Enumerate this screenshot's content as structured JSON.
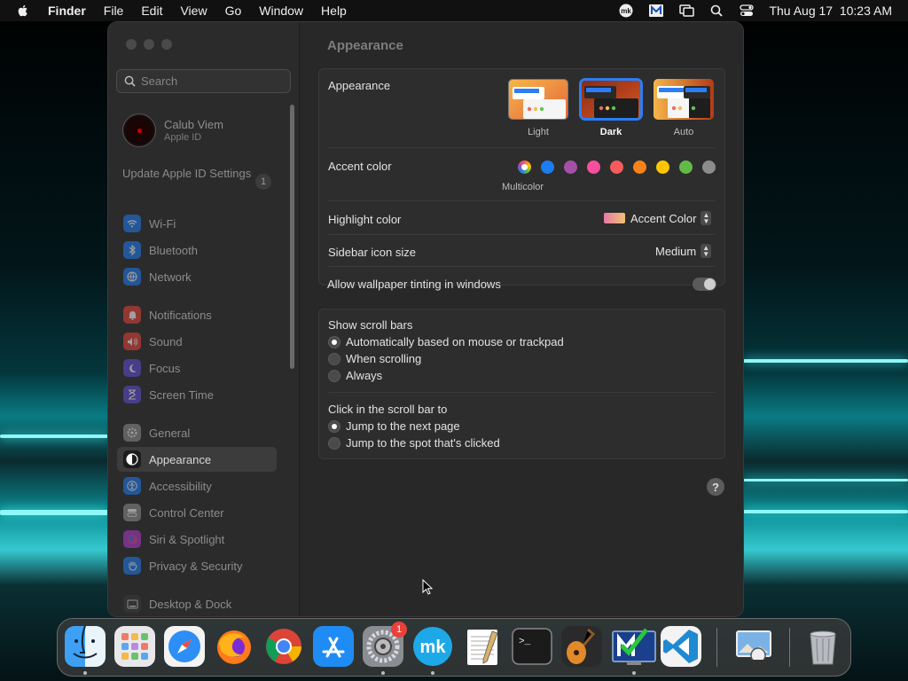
{
  "menubar": {
    "app_name": "Finder",
    "menus": [
      "File",
      "Edit",
      "View",
      "Go",
      "Window",
      "Help"
    ],
    "status_icons": [
      "mk-icon",
      "malwarebytes-icon",
      "display-icon",
      "search-icon",
      "control-center-icon"
    ],
    "datetime": "Thu Aug 17  10:23 AM"
  },
  "sidebar": {
    "search_placeholder": "Search",
    "profile": {
      "name": "Calub Viem",
      "subtitle": "Apple ID"
    },
    "update": {
      "label": "Update Apple ID Settings",
      "badge": "1"
    },
    "items": [
      {
        "label": "Wi-Fi",
        "icon": "wifi-icon",
        "color": "#1e7cf2"
      },
      {
        "label": "Bluetooth",
        "icon": "bluetooth-icon",
        "color": "#1e7cf2"
      },
      {
        "label": "Network",
        "icon": "globe-icon",
        "color": "#1e7cf2"
      },
      {
        "label": "Notifications",
        "icon": "bell-icon",
        "color": "#e8413b"
      },
      {
        "label": "Sound",
        "icon": "speaker-icon",
        "color": "#e8413b"
      },
      {
        "label": "Focus",
        "icon": "moon-icon",
        "color": "#5d4fd6"
      },
      {
        "label": "Screen Time",
        "icon": "hourglass-icon",
        "color": "#5d4fd6"
      },
      {
        "label": "General",
        "icon": "gear-icon",
        "color": "#8e8e8e"
      },
      {
        "label": "Appearance",
        "icon": "appearance-icon",
        "color": "#1c1c1c"
      },
      {
        "label": "Accessibility",
        "icon": "accessibility-icon",
        "color": "#1e7cf2"
      },
      {
        "label": "Control Center",
        "icon": "control-center-icon",
        "color": "#8e8e8e"
      },
      {
        "label": "Siri & Spotlight",
        "icon": "siri-icon",
        "color": "#b03bd0"
      },
      {
        "label": "Privacy & Security",
        "icon": "hand-icon",
        "color": "#1e7cf2"
      },
      {
        "label": "Desktop & Dock",
        "icon": "dock-icon",
        "color": "#3a3a3a"
      }
    ],
    "selected": "Appearance"
  },
  "main": {
    "title": "Appearance",
    "appearance": {
      "label": "Appearance",
      "options": [
        "Light",
        "Dark",
        "Auto"
      ],
      "selected": "Dark"
    },
    "accent": {
      "label": "Accent color",
      "colors": [
        "multicolor",
        "#1e7cf2",
        "#a550a7",
        "#f74f9e",
        "#f75b5b",
        "#f7821b",
        "#ffc600",
        "#62ba46",
        "#8c8c8c"
      ],
      "selected_label": "Multicolor"
    },
    "highlight": {
      "label": "Highlight color",
      "value": "Accent Color"
    },
    "sidebar_icon_size": {
      "label": "Sidebar icon size",
      "value": "Medium"
    },
    "wallpaper_tinting": {
      "label": "Allow wallpaper tinting in windows",
      "on": false
    },
    "scroll_bars": {
      "label": "Show scroll bars",
      "options": [
        "Automatically based on mouse or trackpad",
        "When scrolling",
        "Always"
      ],
      "selected": 0
    },
    "click_scroll": {
      "label": "Click in the scroll bar to",
      "options": [
        "Jump to the next page",
        "Jump to the spot that's clicked"
      ],
      "selected": 0
    },
    "help_label": "?"
  },
  "dock": {
    "apps": [
      {
        "name": "Finder",
        "icon": "finder-icon",
        "running": true
      },
      {
        "name": "Launchpad",
        "icon": "launchpad-icon",
        "running": false
      },
      {
        "name": "Safari",
        "icon": "safari-icon",
        "running": false
      },
      {
        "name": "Firefox",
        "icon": "firefox-icon",
        "running": false
      },
      {
        "name": "Chrome",
        "icon": "chrome-icon",
        "running": false
      },
      {
        "name": "App Store",
        "icon": "app-store-icon",
        "running": false
      },
      {
        "name": "System Settings",
        "icon": "system-settings-icon",
        "running": true,
        "badge": "1"
      },
      {
        "name": "mk",
        "icon": "mk-icon",
        "running": true
      },
      {
        "name": "TextEdit",
        "icon": "textedit-icon",
        "running": false
      },
      {
        "name": "Terminal",
        "icon": "terminal-icon",
        "running": false
      },
      {
        "name": "GarageBand",
        "icon": "garageband-icon",
        "running": false
      },
      {
        "name": "Malwarebytes",
        "icon": "malwarebytes-icon",
        "running": true
      },
      {
        "name": "VS Code",
        "icon": "vscode-icon",
        "running": false
      },
      {
        "name": "Preview",
        "icon": "preview-icon",
        "running": false
      },
      {
        "name": "Trash",
        "icon": "trash-icon",
        "running": false
      }
    ],
    "terminal_glyph": ">_"
  }
}
